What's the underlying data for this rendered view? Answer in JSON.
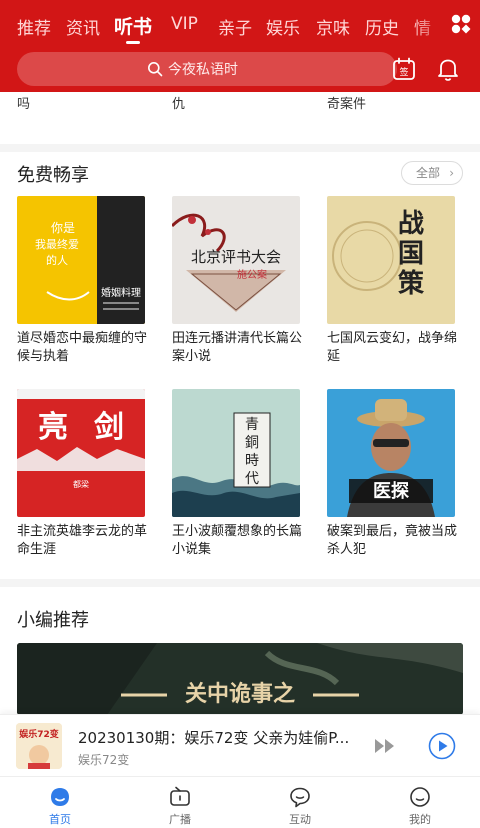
{
  "header": {
    "tabs": [
      "推荐",
      "资讯",
      "听书",
      "VIP",
      "亲子",
      "娱乐",
      "京味",
      "历史",
      "情"
    ],
    "active_tab": "听书",
    "search_placeholder": "今夜私语时",
    "calendar_icon_text": "签"
  },
  "prev_section": {
    "titles": [
      "吗",
      "仇",
      "奇案件"
    ]
  },
  "free_section": {
    "title": "免费畅享",
    "all_label": "全部",
    "books": [
      {
        "caption": "道尽婚恋中最痴缠的守候与执着",
        "cover_text": [
          "你是",
          "我最终爱",
          "的人"
        ],
        "cover_side": "婚姻料理"
      },
      {
        "caption": "田连元播讲清代长篇公案小说",
        "cover_text": [
          "北京评书大会"
        ],
        "cover_side": "施公案"
      },
      {
        "caption": "七国风云变幻，战争绵延",
        "cover_text": [
          "战",
          "国",
          "策"
        ]
      },
      {
        "caption": "非主流英雄李云龙的革命生涯",
        "cover_text": [
          "亮",
          "剑"
        ],
        "cover_side": "都梁"
      },
      {
        "caption": "王小波颠覆想象的长篇小说集",
        "cover_text": [
          "青",
          "銅",
          "時",
          "代"
        ]
      },
      {
        "caption": "破案到最后，竟被当成杀人犯",
        "cover_text": [
          "医探"
        ]
      }
    ]
  },
  "editor_section": {
    "title": "小编推荐",
    "banner_text": "关中诡事之"
  },
  "player": {
    "title": "20230130期：娱乐72变 父亲为娃偷P...",
    "subtitle": "娱乐72变",
    "thumb_text": "娱乐72变"
  },
  "nav": {
    "items": [
      {
        "label": "首页",
        "icon": "home-icon",
        "active": true
      },
      {
        "label": "广播",
        "icon": "radio-icon",
        "active": false
      },
      {
        "label": "互动",
        "icon": "chat-icon",
        "active": false
      },
      {
        "label": "我的",
        "icon": "profile-icon",
        "active": false
      }
    ]
  },
  "colors": {
    "brand": "#d21616",
    "accent": "#2f7be8"
  }
}
